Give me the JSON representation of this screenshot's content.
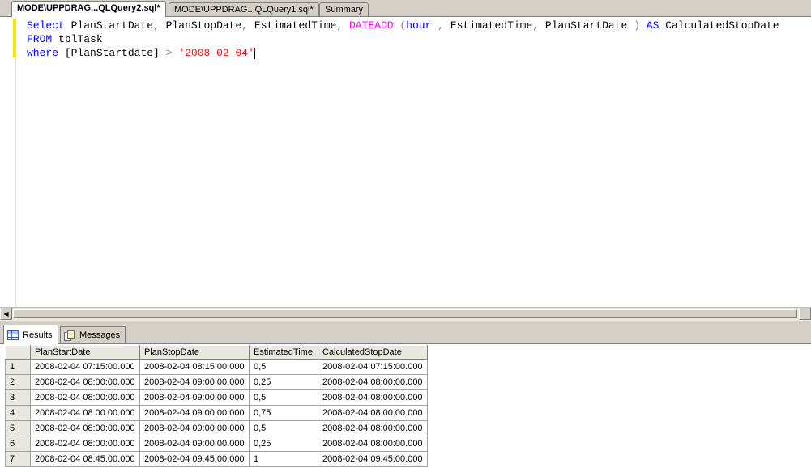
{
  "tabs": [
    {
      "label": "MODE\\UPPDRAG...QLQuery2.sql*",
      "active": true
    },
    {
      "label": "MODE\\UPPDRAG...QLQuery1.sql*",
      "active": false
    },
    {
      "label": "Summary",
      "active": false
    }
  ],
  "editor": {
    "line1": {
      "select": "Select",
      "cols": "PlanStartDate",
      "c1": ",",
      "col2": "PlanStopDate",
      "c2": ",",
      "col3": "EstimatedTime",
      "c3": ",",
      "fn": "DATEADD",
      "open": "(",
      "datepart": "hour",
      "c4": ",",
      "arg2": "EstimatedTime",
      "c5": ",",
      "arg3": "PlanStartDate",
      "close": ")",
      "as": "AS",
      "alias": "CalculatedStopDate"
    },
    "line2": {
      "from": "FROM",
      "table": "tblTask"
    },
    "line3": {
      "where": "where",
      "col": "[PlanStartdate]",
      "op": ">",
      "value": "'2008-02-04'"
    }
  },
  "result_tabs": [
    {
      "label": "Results",
      "icon": "grid-icon",
      "active": true
    },
    {
      "label": "Messages",
      "icon": "messages-icon",
      "active": false
    }
  ],
  "grid": {
    "columns": [
      "PlanStartDate",
      "PlanStopDate",
      "EstimatedTime",
      "CalculatedStopDate"
    ],
    "rows": [
      {
        "n": "1",
        "cells": [
          "2008-02-04 07:15:00.000",
          "2008-02-04 08:15:00.000",
          "0,5",
          "2008-02-04 07:15:00.000"
        ]
      },
      {
        "n": "2",
        "cells": [
          "2008-02-04 08:00:00.000",
          "2008-02-04 09:00:00.000",
          "0,25",
          "2008-02-04 08:00:00.000"
        ]
      },
      {
        "n": "3",
        "cells": [
          "2008-02-04 08:00:00.000",
          "2008-02-04 09:00:00.000",
          "0,5",
          "2008-02-04 08:00:00.000"
        ]
      },
      {
        "n": "4",
        "cells": [
          "2008-02-04 08:00:00.000",
          "2008-02-04 09:00:00.000",
          "0,75",
          "2008-02-04 08:00:00.000"
        ]
      },
      {
        "n": "5",
        "cells": [
          "2008-02-04 08:00:00.000",
          "2008-02-04 09:00:00.000",
          "0,5",
          "2008-02-04 08:00:00.000"
        ]
      },
      {
        "n": "6",
        "cells": [
          "2008-02-04 08:00:00.000",
          "2008-02-04 09:00:00.000",
          "0,25",
          "2008-02-04 08:00:00.000"
        ]
      },
      {
        "n": "7",
        "cells": [
          "2008-02-04 08:45:00.000",
          "2008-02-04 09:45:00.000",
          "1",
          "2008-02-04 09:45:00.000"
        ]
      }
    ]
  },
  "colors": {
    "keyword": "#0000ff",
    "function": "#ff00ff",
    "string": "#ff0000",
    "operator": "#808080"
  }
}
